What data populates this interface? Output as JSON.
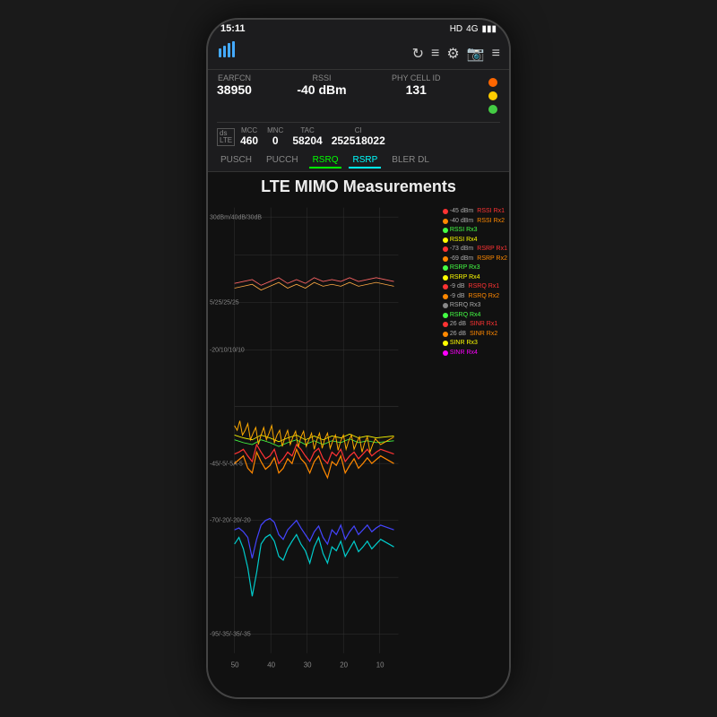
{
  "status_bar": {
    "time": "15:11",
    "network": "HD",
    "signal": "4G",
    "right_icons": "▣ ☰"
  },
  "toolbar": {
    "logo": "📶",
    "icons": [
      "↻",
      "≡",
      "⚙",
      "📷",
      "≡"
    ]
  },
  "metrics": {
    "earfcn_label": "EARFCN",
    "earfcn_value": "38950",
    "rssi_label": "RSSI",
    "rssi_value": "-40 dBm",
    "phy_cell_label": "Phy Cell ID",
    "phy_cell_value": "131",
    "mcc_label": "MCC",
    "mcc_value": "460",
    "mnc_label": "MNC",
    "mnc_value": "0",
    "tac_label": "TAC",
    "tac_value": "58204",
    "ci_label": "CI",
    "ci_value": "252518022"
  },
  "tabs": [
    {
      "label": "PUSCH",
      "active": false
    },
    {
      "label": "PUCCH",
      "active": false
    },
    {
      "label": "RSRQ",
      "active": true,
      "color": "green"
    },
    {
      "label": "RSRP",
      "active": true,
      "color": "teal"
    },
    {
      "label": "BLER DL",
      "active": false
    }
  ],
  "chart": {
    "title": "LTE MIMO Measurements",
    "y_labels": [
      {
        "text": "30 dBm/40 dB/30 dB",
        "pct": 5
      },
      {
        "text": "5/25/25/25",
        "pct": 28
      },
      {
        "text": "-20/10/10/10",
        "pct": 50
      },
      {
        "text": "-45/-5/-5A-5",
        "pct": 67
      },
      {
        "text": "-70/-20/-20/-20",
        "pct": 80
      },
      {
        "text": "-95/-35/-35/-35",
        "pct": 92
      }
    ],
    "x_labels": [
      "50",
      "40",
      "30",
      "20",
      "10"
    ],
    "legend": [
      {
        "label": "-45 dBm  RSSI Rx1",
        "color": "#ff4444"
      },
      {
        "label": "-40 dBm  RSSI Rx2",
        "color": "#ff8800"
      },
      {
        "label": "RSSI Rx3",
        "color": "#44ff44"
      },
      {
        "label": "RSSI Rx4",
        "color": "#ffff00"
      },
      {
        "label": "-73 dBm  RSRP Rx1",
        "color": "#ff4444"
      },
      {
        "label": "-69 dBm  RSRP Rx2",
        "color": "#ff8800"
      },
      {
        "label": "RSRP Rx3",
        "color": "#44ff44"
      },
      {
        "label": "RSRP Rx4",
        "color": "#ffff00"
      },
      {
        "label": "-9 dB  RSRQ Rx1",
        "color": "#ff4444"
      },
      {
        "label": "-9 dB  RSRQ Rx2",
        "color": "#ff8800"
      },
      {
        "label": "RSRQ Rx3",
        "color": "#888"
      },
      {
        "label": "RSRQ Rx4",
        "color": "#44ff44"
      },
      {
        "label": "26 dB  SINR Rx1",
        "color": "#ff4444"
      },
      {
        "label": "26 dB  SINR Rx2",
        "color": "#ff8800"
      },
      {
        "label": "SINR Rx3",
        "color": "#ffff00"
      },
      {
        "label": "SINR Rx4",
        "color": "#ff00ff"
      }
    ]
  }
}
